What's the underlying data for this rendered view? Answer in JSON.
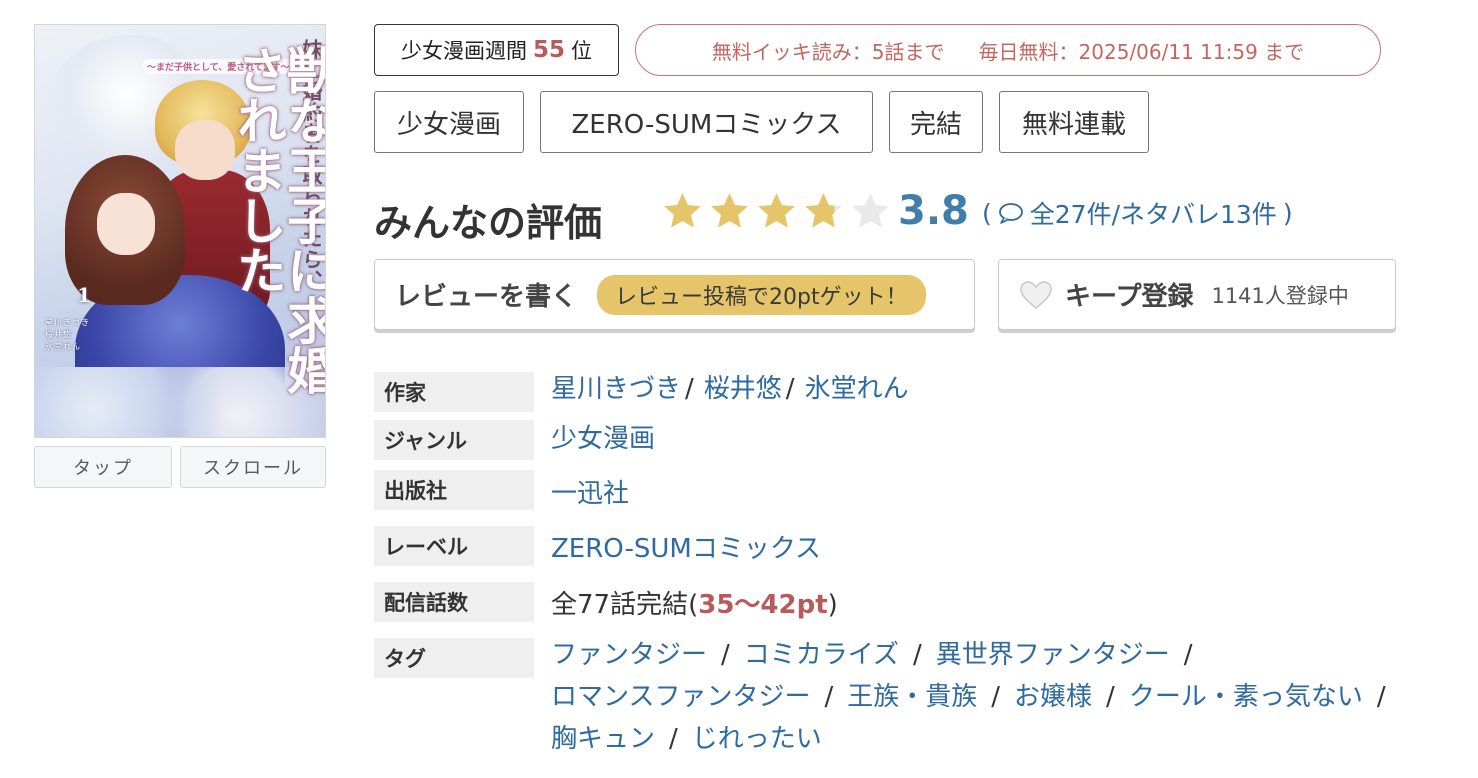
{
  "cover": {
    "subtitle": "〜まだ子供として、愛されてます〜",
    "title_small": "妹に婚約者を取られたら、",
    "title_big": "獣な王子に求婚されました",
    "volume": "1",
    "credits": [
      "星川きづき",
      "桜井悠",
      "氷堂れん"
    ]
  },
  "view_buttons": {
    "tap": "タップ",
    "scroll": "スクロール"
  },
  "rank": {
    "prefix": "少女漫画週間",
    "number": "55",
    "suffix": "位"
  },
  "free_banner": {
    "left": "無料イッキ読み：5話まで",
    "right": "毎日無料：2025/06/11 11:59 まで"
  },
  "tags_top": [
    "少女漫画",
    "ZERO-SUMコミックス",
    "完結",
    "無料連載"
  ],
  "rating": {
    "title": "みんなの評価",
    "score": "3.8",
    "stars": 3.8,
    "reviews_open": "(",
    "reviews_link": "全27件/ネタバレ13件",
    "reviews_close": ")"
  },
  "review_button": {
    "label": "レビューを書く",
    "pill": "レビュー投稿で20ptゲット！"
  },
  "keep_button": {
    "label": "キープ登録",
    "count": "1141人登録中"
  },
  "info": {
    "author_label": "作家",
    "authors": [
      "星川きづき",
      "桜井悠",
      "氷堂れん"
    ],
    "author_sep": "/",
    "genre_label": "ジャンル",
    "genre": "少女漫画",
    "publisher_label": "出版社",
    "publisher": "一迅社",
    "label_label": "レーベル",
    "label": "ZERO-SUMコミックス",
    "episodes_label": "配信話数",
    "episodes_prefix": "全77話完結(",
    "episodes_pt": "35〜42pt",
    "episodes_suffix": ")",
    "tags_label": "タグ",
    "tag_sep": "/",
    "tags": [
      "ファンタジー",
      "コミカライズ",
      "異世界ファンタジー",
      "ロマンスファンタジー",
      "王族・貴族",
      "お嬢様",
      "クール・素っ気ない",
      "胸キュン",
      "じれったい"
    ]
  },
  "colors": {
    "link": "#2f6aa0",
    "accent_red": "#b95a5a",
    "star": "#e6c56a",
    "score_blue": "#3f7ea9",
    "pill": "#e6c56a"
  }
}
